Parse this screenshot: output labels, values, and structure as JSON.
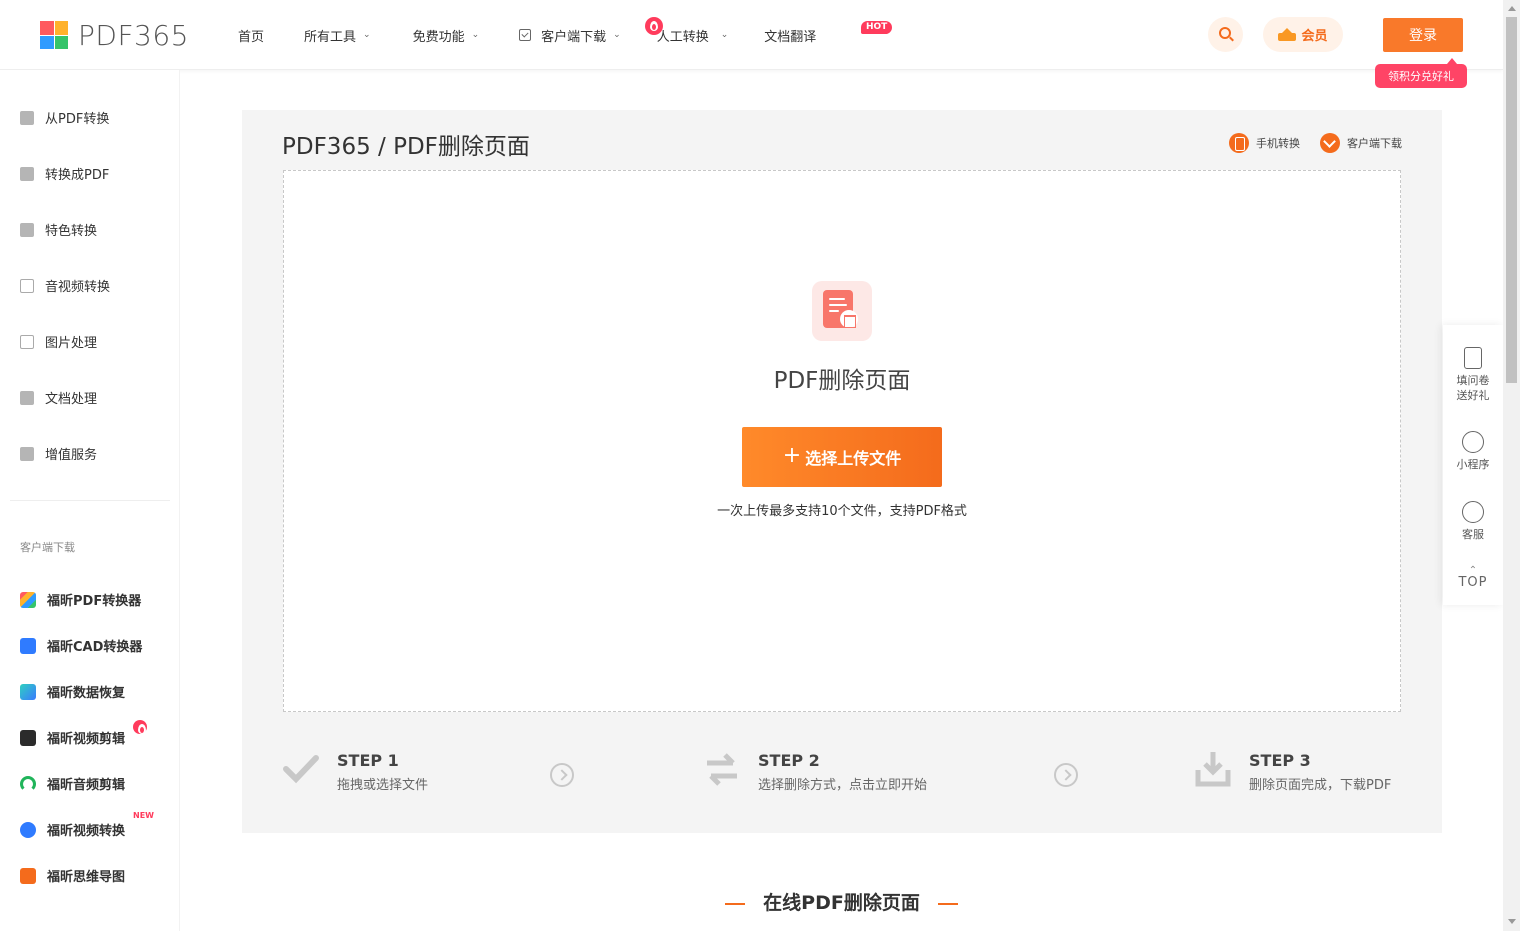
{
  "header": {
    "logo_text": "PDF365",
    "nav": [
      {
        "label": "首页"
      },
      {
        "label": "所有工具"
      },
      {
        "label": "免费功能"
      },
      {
        "label": "客户端下载"
      },
      {
        "label": "人工转换"
      },
      {
        "label": "文档翻译"
      }
    ],
    "hot_badge": "HOT",
    "vip_label": "会员",
    "login_label": "登录",
    "login_tip": "领积分兑好礼"
  },
  "sidebar": {
    "items": [
      {
        "label": "从PDF转换"
      },
      {
        "label": "转换成PDF"
      },
      {
        "label": "特色转换"
      },
      {
        "label": "音视频转换"
      },
      {
        "label": "图片处理"
      },
      {
        "label": "文档处理"
      },
      {
        "label": "增值服务"
      }
    ],
    "download_caption": "客户端下载",
    "apps": [
      {
        "label": "福昕PDF转换器"
      },
      {
        "label": "福昕CAD转换器"
      },
      {
        "label": "福昕数据恢复"
      },
      {
        "label": "福昕视频剪辑"
      },
      {
        "label": "福昕音频剪辑"
      },
      {
        "label": "福昕视频转换"
      },
      {
        "label": "福昕思维导图"
      }
    ],
    "new_badge": "NEW"
  },
  "main": {
    "title": "PDF365 / PDF删除页面",
    "link_mobile": "手机转换",
    "link_client": "客户端下载",
    "tool_name": "PDF删除页面",
    "upload_button": "选择上传文件",
    "upload_plus": "+",
    "upload_hint": "一次上传最多支持10个文件，支持PDF格式",
    "steps": [
      {
        "title": "STEP 1",
        "desc": "拖拽或选择文件"
      },
      {
        "title": "STEP 2",
        "desc": "选择删除方式，点击立即开始"
      },
      {
        "title": "STEP 3",
        "desc": "删除页面完成，下载PDF"
      }
    ],
    "section_title": "在线PDF删除页面"
  },
  "float_bar": {
    "survey_line1": "填问卷",
    "survey_line2": "送好礼",
    "miniapp": "小程序",
    "service": "客服",
    "top": "TOP"
  },
  "colors": {
    "accent": "#f46b1c",
    "login": "#f9792a",
    "hot": "#ff3b5c"
  }
}
